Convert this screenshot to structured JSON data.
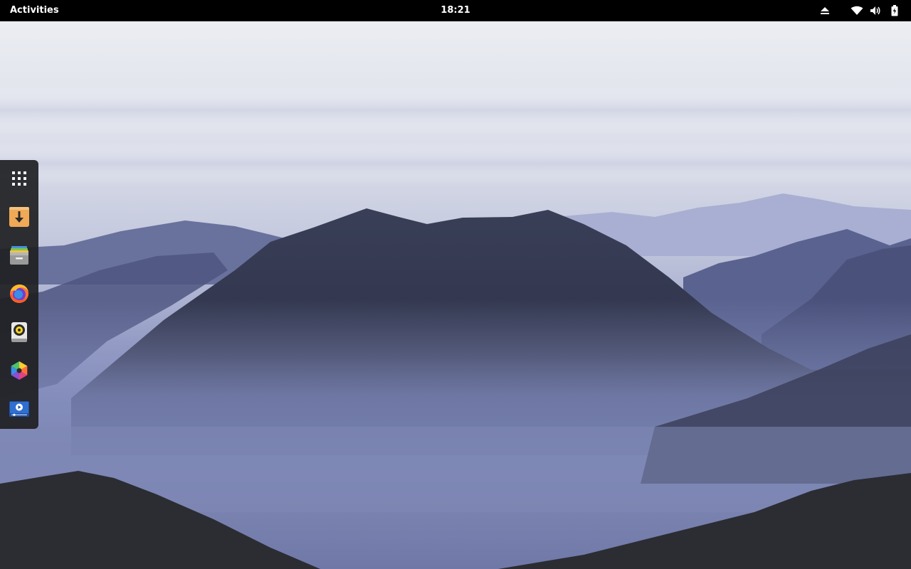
{
  "topbar": {
    "activities_label": "Activities",
    "clock": "18:21",
    "tray": [
      {
        "name": "eject-icon"
      },
      {
        "name": "wifi-icon"
      },
      {
        "name": "volume-icon"
      },
      {
        "name": "battery-icon"
      }
    ]
  },
  "dock": {
    "items": [
      {
        "name": "show-applications-icon"
      },
      {
        "name": "downloads-icon"
      },
      {
        "name": "files-archive-icon"
      },
      {
        "name": "firefox-icon"
      },
      {
        "name": "rhythmbox-icon"
      },
      {
        "name": "color-wheel-icon"
      },
      {
        "name": "video-player-icon"
      }
    ]
  },
  "colors": {
    "topbar_bg": "#000000",
    "dock_bg": "#1e1f22",
    "sky_top": "#eceef3",
    "mountain_dark": "#2f3449",
    "haze": "#7d86b3"
  }
}
